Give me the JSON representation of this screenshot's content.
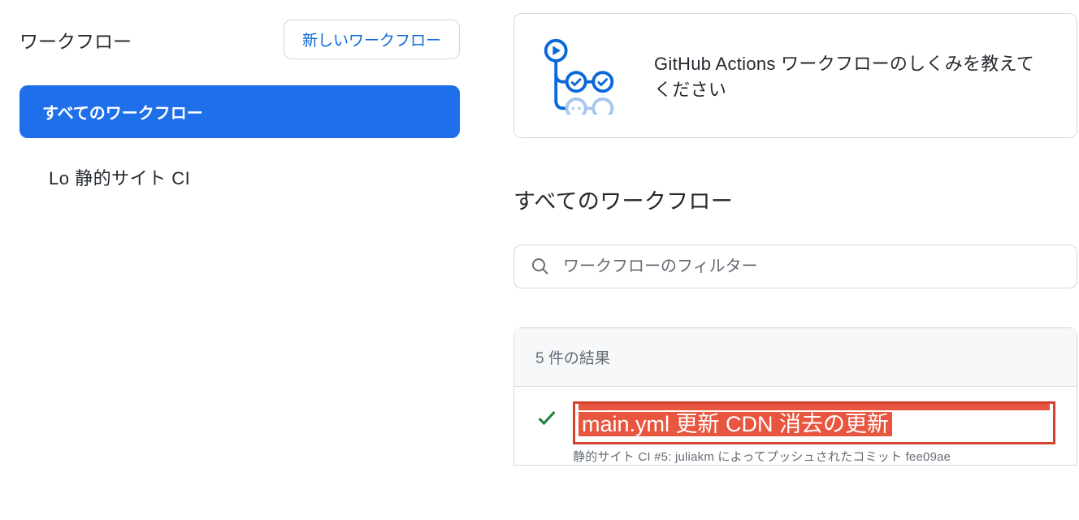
{
  "sidebar": {
    "title": "ワークフロー",
    "new_button": "新しいワークフロー",
    "items": [
      {
        "label": "すべてのワークフロー"
      },
      {
        "label": "Lo 静的サイト CI"
      }
    ]
  },
  "help": {
    "text": "GitHub Actions ワークフローのしくみを教えてください"
  },
  "main": {
    "heading": "すべてのワークフロー",
    "filter_placeholder": "ワークフローのフィルター",
    "results_count_label": "5 件の結果",
    "runs": [
      {
        "title": "main.yml 更新 CDN 消去の更新",
        "meta": "静的サイト CI #5: juliakm によってプッシュされたコミット fee09ae"
      }
    ]
  }
}
